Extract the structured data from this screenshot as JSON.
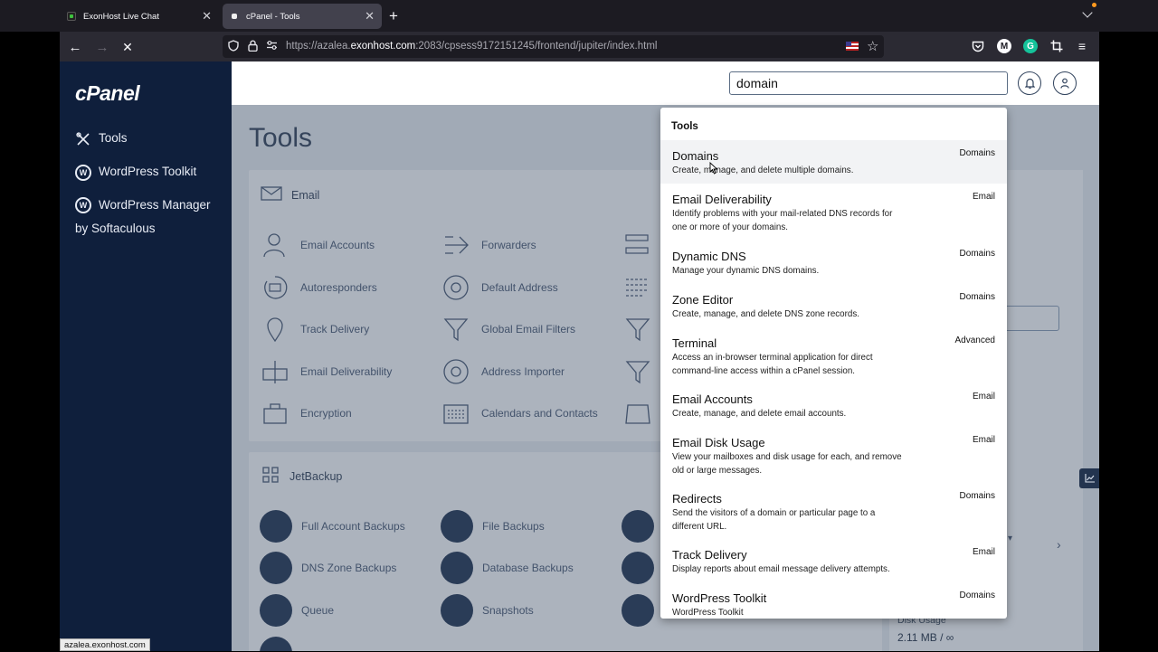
{
  "browser": {
    "tabs": [
      {
        "title": "ExonHost Live Chat"
      },
      {
        "title": "cPanel - Tools"
      }
    ],
    "url_dim_prefix": "https://azalea.",
    "url_domain": "exonhost.com",
    "url_rest": ":2083/cpsess9172151245/frontend/jupiter/index.html",
    "status_url": "azalea.exonhost.com",
    "toolbar_icons": [
      "pocket-icon",
      "account-icon",
      "grammarly-icon",
      "screenshot-icon",
      "menu-icon"
    ]
  },
  "sidebar": {
    "logo": "cPanel",
    "items": [
      {
        "label": "Tools",
        "icon": "tools-icon"
      },
      {
        "label": "WordPress Toolkit",
        "icon": "wordpress-icon"
      },
      {
        "label": "WordPress Manager by Softaculous",
        "icon": "wordpress-icon"
      }
    ]
  },
  "header": {
    "search_value": "domain",
    "icons": [
      "bell-icon",
      "user-icon"
    ]
  },
  "main": {
    "page_title": "Tools",
    "email_section": {
      "title": "Email",
      "tools": [
        "Email Accounts",
        "Forwarders",
        "Autoresponders",
        "Default Address",
        "Track Delivery",
        "Global Email Filters",
        "Email Deliverability",
        "Address Importer",
        "Encryption",
        "Calendars and Contacts"
      ]
    },
    "jetbackup_section": {
      "title": "JetBackup",
      "tools": [
        "Full Account Backups",
        "File Backups",
        "DNS Zone Backups",
        "Database Backups",
        "Queue",
        "Snapshots"
      ]
    },
    "stats": {
      "disk_label": "Disk Usage",
      "disk_value": "2.11 MB / ∞"
    }
  },
  "dropdown": {
    "heading": "Tools",
    "items": [
      {
        "title": "Domains",
        "desc": "Create, manage, and delete multiple domains.",
        "category": "Domains"
      },
      {
        "title": "Email Deliverability",
        "desc": "Identify problems with your mail-related DNS records for one or more of your domains.",
        "category": "Email"
      },
      {
        "title": "Dynamic DNS",
        "desc": "Manage your dynamic DNS domains.",
        "category": "Domains"
      },
      {
        "title": "Zone Editor",
        "desc": "Create, manage, and delete DNS zone records.",
        "category": "Domains"
      },
      {
        "title": "Terminal",
        "desc": "Access an in-browser terminal application for direct command-line access within a cPanel session.",
        "category": "Advanced"
      },
      {
        "title": "Email Accounts",
        "desc": "Create, manage, and delete email accounts.",
        "category": "Email"
      },
      {
        "title": "Email Disk Usage",
        "desc": "View your mailboxes and disk usage for each, and remove old or large messages.",
        "category": "Email"
      },
      {
        "title": "Redirects",
        "desc": "Send the visitors of a domain or particular page to a different URL.",
        "category": "Domains"
      },
      {
        "title": "Track Delivery",
        "desc": "Display reports about email message delivery attempts.",
        "category": "Email"
      },
      {
        "title": "WordPress Toolkit",
        "desc": "WordPress Toolkit",
        "category": "Domains"
      }
    ]
  }
}
